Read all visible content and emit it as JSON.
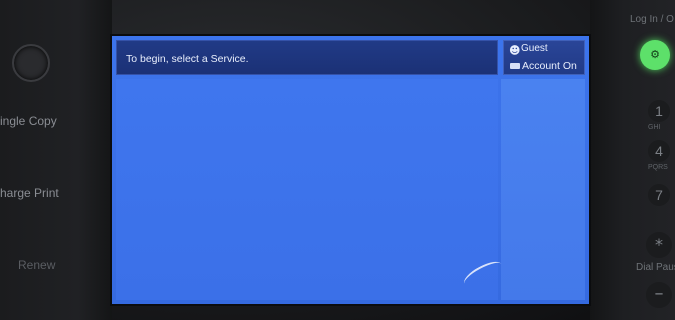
{
  "screen": {
    "prompt": "To begin, select a Service.",
    "user": "Guest",
    "account_status": "Account On"
  },
  "left_panel": {
    "items": [
      {
        "label": "ingle Copy"
      },
      {
        "label": "harge Print"
      },
      {
        "label": "Renew"
      }
    ]
  },
  "right_panel": {
    "login_label": "Log In / O",
    "keys": [
      {
        "label": "1",
        "sub": "GHI"
      },
      {
        "label": "4",
        "sub": "PQRS"
      },
      {
        "label": "7",
        "sub": ""
      }
    ],
    "star_label": "*",
    "dial_pause_label": "Dial Pause",
    "minus_label": "–"
  },
  "icons": {
    "guest": "user-icon",
    "account": "card-icon",
    "login": "key-icon"
  },
  "colors": {
    "screen_blue": "#3b70e8",
    "title_bar": "#1b3176",
    "login_green": "#5de06a"
  }
}
